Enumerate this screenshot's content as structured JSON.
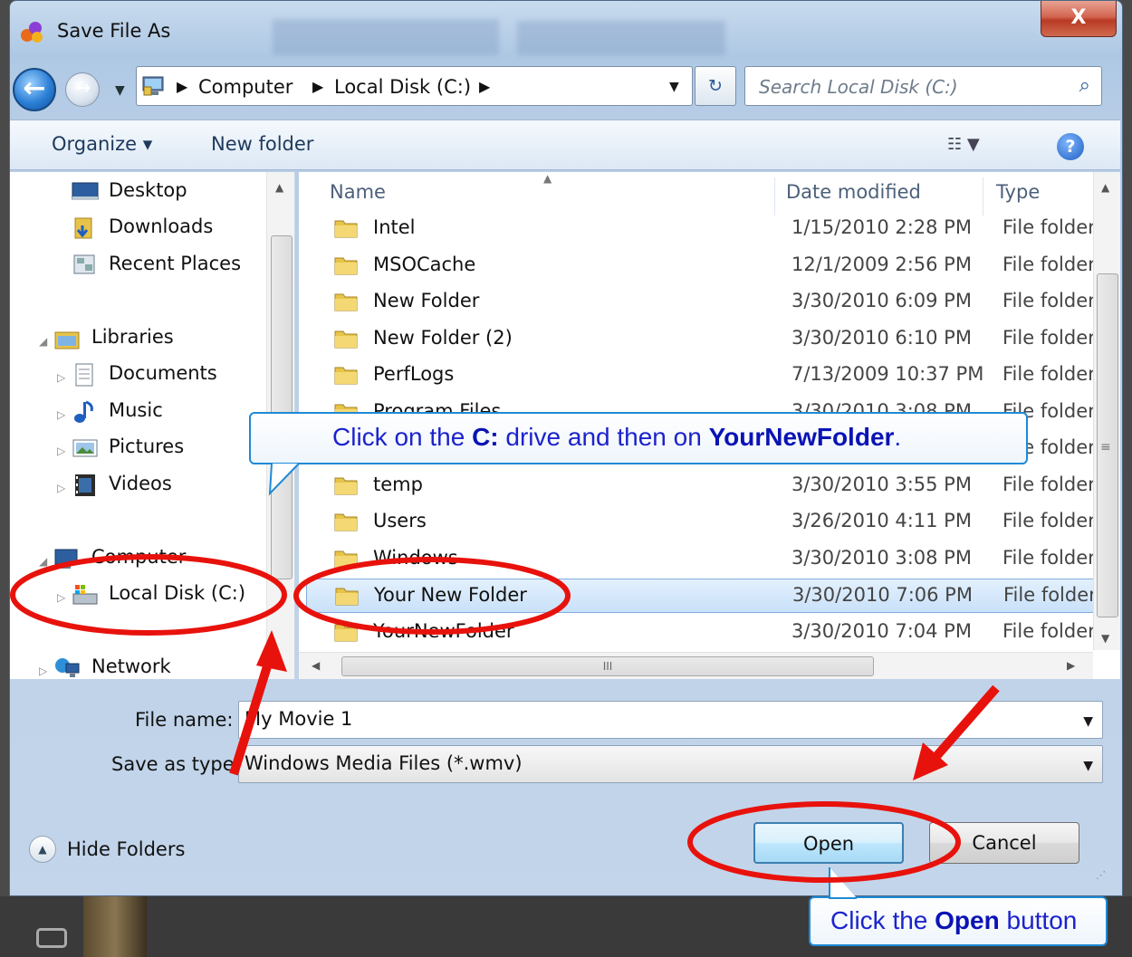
{
  "window": {
    "title": "Save File As",
    "close_glyph": "X",
    "accent": "#2b7fd6"
  },
  "nav": {
    "back_glyph": "←",
    "breadcrumb": [
      "Computer",
      "Local Disk (C:)"
    ],
    "search_placeholder": "Search Local Disk (C:)"
  },
  "toolbar": {
    "organize": "Organize ▾",
    "new_folder": "New folder",
    "help": "?"
  },
  "sidebar": {
    "favorites": [
      {
        "label": "Desktop",
        "icon": "desktop-icon"
      },
      {
        "label": "Downloads",
        "icon": "downloads-folder-icon"
      },
      {
        "label": "Recent Places",
        "icon": "recent-places-icon"
      }
    ],
    "libraries_label": "Libraries",
    "libraries": [
      {
        "label": "Documents",
        "icon": "documents-icon"
      },
      {
        "label": "Music",
        "icon": "music-icon"
      },
      {
        "label": "Pictures",
        "icon": "pictures-icon"
      },
      {
        "label": "Videos",
        "icon": "videos-icon"
      }
    ],
    "computer_label": "Computer",
    "local_disk_label": "Local Disk (C:)",
    "network_label": "Network"
  },
  "files": {
    "columns": {
      "name": "Name",
      "date": "Date modified",
      "type": "Type"
    },
    "rows": [
      {
        "name": "Intel",
        "date": "1/15/2010 2:28 PM",
        "type": "File folder"
      },
      {
        "name": "MSOCache",
        "date": "12/1/2009 2:56 PM",
        "type": "File folder"
      },
      {
        "name": "New Folder",
        "date": "3/30/2010 6:09 PM",
        "type": "File folder"
      },
      {
        "name": "New Folder (2)",
        "date": "3/30/2010 6:10 PM",
        "type": "File folder"
      },
      {
        "name": "PerfLogs",
        "date": "7/13/2009 10:37 PM",
        "type": "File folder"
      },
      {
        "name": "Program Files",
        "date": "3/30/2010 3:08 PM",
        "type": "File folder"
      },
      {
        "name": "",
        "date": "",
        "type": "File folder"
      },
      {
        "name": "temp",
        "date": "3/30/2010 3:55 PM",
        "type": "File folder"
      },
      {
        "name": "Users",
        "date": "3/26/2010 4:11 PM",
        "type": "File folder"
      },
      {
        "name": "Windows",
        "date": "3/30/2010 3:08 PM",
        "type": "File folder"
      },
      {
        "name": "Your New Folder",
        "date": "3/30/2010 7:06 PM",
        "type": "File folder",
        "selected": true
      },
      {
        "name": "YourNewFolder",
        "date": "3/30/2010 7:04 PM",
        "type": "File folder"
      }
    ],
    "hscroll_glyph": "III"
  },
  "form": {
    "file_name_label": "File name:",
    "file_name_value": "My Movie 1",
    "save_type_label": "Save as type:",
    "save_type_value": "Windows Media Files (*.wmv)"
  },
  "footer": {
    "hide_folders": "Hide Folders",
    "open": "Open",
    "cancel": "Cancel"
  },
  "annotations": {
    "callout1": {
      "pre": "Click on the ",
      "b1": "C:",
      "mid": " drive and then on ",
      "b2": "YourNewFolder",
      "post": "."
    },
    "callout2": {
      "pre": "Click the ",
      "b1": "Open",
      "post": " button"
    },
    "marker_color": "#e8120c",
    "callout_text_color": "#1c23cc"
  }
}
